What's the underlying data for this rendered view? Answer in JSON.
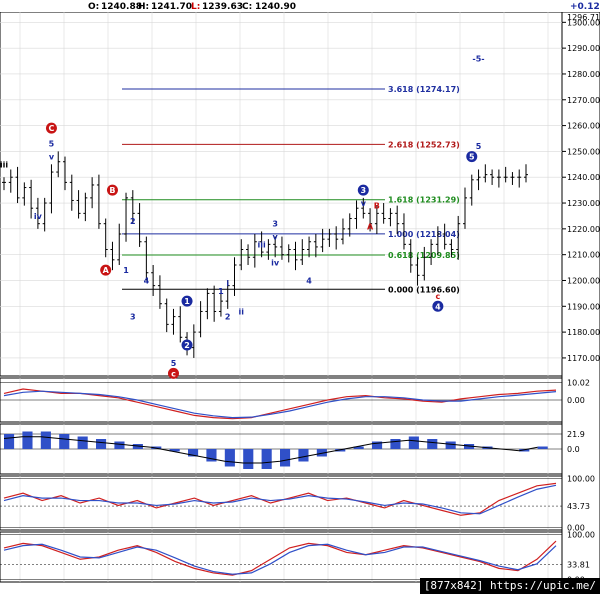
{
  "header": {
    "o_label": "O:",
    "o_value": "1240.88",
    "h_label": "H:",
    "h_value": "1241.70",
    "l_label": "L:",
    "l_value": "1239.63",
    "c_label": "C:",
    "c_value": "1240.90",
    "change": "+0.12"
  },
  "footer": {
    "text": "[877x842] https://upic.me/"
  },
  "colors": {
    "grid": "#d9d9d9",
    "price": "#000000",
    "fib_blue": "#1f2fa0",
    "fib_red": "#b01818",
    "fib_green": "#1e8c1e",
    "wave_blue": "#1a2aa0",
    "wave_red": "#c81414",
    "osc_red": "#d02020",
    "osc_blue": "#3050c8"
  },
  "chart_data": [
    {
      "type": "ohlc",
      "name": "price",
      "ylim": [
        1163,
        1304
      ],
      "yticks": [
        1170,
        1180,
        1190,
        1200,
        1210,
        1220,
        1230,
        1240,
        1250,
        1260,
        1270,
        1280,
        1290,
        1300
      ],
      "ytick_labels": [
        "1170.00",
        "1180.00",
        "1190.00",
        "1200.00",
        "1210.00",
        "1220.00",
        "1230.00",
        "1240.00",
        "1250.00",
        "1260.00",
        "1270.00",
        "1280.00",
        "1290.00",
        "1300.00"
      ],
      "top_label": "1296.71",
      "bars": 78,
      "close": [
        1238,
        1240,
        1232,
        1236,
        1228,
        1222,
        1230,
        1242,
        1246,
        1238,
        1231,
        1226,
        1232,
        1237,
        1222,
        1212,
        1208,
        1218,
        1232,
        1226,
        1215,
        1203,
        1198,
        1191,
        1183,
        1186,
        1178,
        1174,
        1180,
        1188,
        1195,
        1188,
        1192,
        1198,
        1206,
        1212,
        1209,
        1215,
        1211,
        1214,
        1213,
        1210,
        1212,
        1208,
        1212,
        1215,
        1213,
        1216,
        1218,
        1216,
        1220,
        1224,
        1228,
        1226,
        1222,
        1226,
        1224,
        1226,
        1222,
        1214,
        1206,
        1202,
        1209,
        1214,
        1218,
        1214,
        1212,
        1222,
        1232,
        1239,
        1240,
        1241,
        1240,
        1240,
        1240,
        1240,
        1240,
        1241
      ],
      "fib_levels": [
        {
          "ratio": "3.618",
          "value": 1274.17,
          "label": "3.618 (1274.17)",
          "color": "blue"
        },
        {
          "ratio": "2.618",
          "value": 1252.73,
          "label": "2.618 (1252.73)",
          "color": "red"
        },
        {
          "ratio": "1.618",
          "value": 1231.29,
          "label": "1.618 (1231.29)",
          "color": "green"
        },
        {
          "ratio": "1.000",
          "value": 1218.04,
          "label": "1.000 (1218.04)",
          "color": "blue"
        },
        {
          "ratio": "0.618",
          "value": 1209.85,
          "label": "0.618 (1209.85)",
          "color": "green"
        },
        {
          "ratio": "0.000",
          "value": 1196.6,
          "label": "0.000 (1196.60)",
          "color": "black"
        }
      ],
      "wave_labels": [
        {
          "text": "iii",
          "bar": 0,
          "price": 1245,
          "style": "plain-black"
        },
        {
          "text": "C",
          "bar": 7,
          "price": 1259,
          "style": "circle-red"
        },
        {
          "text": "5",
          "bar": 7,
          "price": 1253,
          "style": "plain-blue"
        },
        {
          "text": "v",
          "bar": 7,
          "price": 1248,
          "style": "plain-blue"
        },
        {
          "text": "iv",
          "bar": 5,
          "price": 1225,
          "style": "plain-blue"
        },
        {
          "text": "B",
          "bar": 16,
          "price": 1235,
          "style": "circle-red"
        },
        {
          "text": "2",
          "bar": 19,
          "price": 1223,
          "style": "plain-blue"
        },
        {
          "text": "A",
          "bar": 15,
          "price": 1204,
          "style": "circle-red"
        },
        {
          "text": "1",
          "bar": 18,
          "price": 1204,
          "style": "plain-blue"
        },
        {
          "text": "4",
          "bar": 21,
          "price": 1200,
          "style": "plain-blue"
        },
        {
          "text": "3",
          "bar": 19,
          "price": 1186,
          "style": "plain-blue"
        },
        {
          "text": "1",
          "bar": 27,
          "price": 1192,
          "style": "circle-blue"
        },
        {
          "text": "2",
          "bar": 27,
          "price": 1175,
          "style": "circle-blue"
        },
        {
          "text": "5",
          "bar": 25,
          "price": 1168,
          "style": "plain-blue"
        },
        {
          "text": "c",
          "bar": 25,
          "price": 1164,
          "style": "circle-red"
        },
        {
          "text": "1",
          "bar": 32,
          "price": 1196,
          "style": "plain-blue"
        },
        {
          "text": "i",
          "bar": 33,
          "price": 1199,
          "style": "plain-blue"
        },
        {
          "text": "2",
          "bar": 33,
          "price": 1186,
          "style": "plain-blue"
        },
        {
          "text": "ii",
          "bar": 35,
          "price": 1188,
          "style": "plain-blue"
        },
        {
          "text": "3",
          "bar": 40,
          "price": 1222,
          "style": "plain-blue"
        },
        {
          "text": "v",
          "bar": 40,
          "price": 1217,
          "style": "plain-blue"
        },
        {
          "text": "iii",
          "bar": 38,
          "price": 1214,
          "style": "plain-blue"
        },
        {
          "text": "iv",
          "bar": 40,
          "price": 1207,
          "style": "plain-blue"
        },
        {
          "text": "4",
          "bar": 45,
          "price": 1200,
          "style": "plain-blue"
        },
        {
          "text": "3",
          "bar": 53,
          "price": 1235,
          "style": "circle-blue"
        },
        {
          "text": "v",
          "bar": 53,
          "price": 1230,
          "style": "plain-blue"
        },
        {
          "text": "B",
          "bar": 55,
          "price": 1229,
          "style": "plain-red"
        },
        {
          "text": "A",
          "bar": 54,
          "price": 1221,
          "style": "plain-red"
        },
        {
          "text": "c",
          "bar": 64,
          "price": 1194,
          "style": "plain-red"
        },
        {
          "text": "4",
          "bar": 64,
          "price": 1190,
          "style": "circle-blue"
        },
        {
          "text": "5",
          "bar": 69,
          "price": 1248,
          "style": "circle-blue"
        },
        {
          "text": "5",
          "bar": 70,
          "price": 1252,
          "style": "plain-blue"
        },
        {
          "text": "-5-",
          "bar": 70,
          "price": 1286,
          "style": "plain-blue"
        }
      ]
    },
    {
      "type": "line",
      "name": "macd",
      "ylim": [
        -1,
        1
      ],
      "yticks": [
        0.8,
        0
      ],
      "ytick_labels": [
        "10.02",
        "0.00"
      ],
      "series": [
        {
          "color": "red",
          "values": [
            0.3,
            0.5,
            0.4,
            0.3,
            0.3,
            0.2,
            0.1,
            -0.1,
            -0.3,
            -0.5,
            -0.7,
            -0.8,
            -0.85,
            -0.8,
            -0.6,
            -0.4,
            -0.2,
            0.0,
            0.15,
            0.2,
            0.1,
            0.05,
            -0.05,
            -0.1,
            0.05,
            0.15,
            0.25,
            0.3,
            0.4,
            0.45
          ]
        },
        {
          "color": "blue",
          "values": [
            0.2,
            0.35,
            0.4,
            0.35,
            0.3,
            0.25,
            0.15,
            0.0,
            -0.2,
            -0.4,
            -0.6,
            -0.72,
            -0.8,
            -0.78,
            -0.65,
            -0.5,
            -0.3,
            -0.1,
            0.05,
            0.15,
            0.15,
            0.1,
            0.0,
            -0.05,
            -0.05,
            0.05,
            0.15,
            0.22,
            0.3,
            0.38
          ]
        }
      ]
    },
    {
      "type": "bar",
      "name": "histogram",
      "ylim": [
        -1,
        1
      ],
      "yticks": [
        0.6,
        0
      ],
      "ytick_labels": [
        "21.9",
        "0.0"
      ],
      "values": [
        0.6,
        0.7,
        0.7,
        0.6,
        0.5,
        0.4,
        0.3,
        0.2,
        0.1,
        -0.1,
        -0.3,
        -0.5,
        -0.7,
        -0.8,
        -0.8,
        -0.7,
        -0.5,
        -0.3,
        -0.1,
        0.1,
        0.3,
        0.4,
        0.5,
        0.4,
        0.3,
        0.2,
        0.1,
        0.0,
        -0.1,
        0.1
      ]
    },
    {
      "type": "line",
      "name": "stoch-fast",
      "ylim": [
        -5,
        105
      ],
      "yticks": [
        100,
        43.73,
        0
      ],
      "ytick_labels": [
        "100.00",
        "43.73",
        "0.00"
      ],
      "series": [
        {
          "color": "red",
          "values": [
            60,
            70,
            55,
            65,
            50,
            60,
            45,
            55,
            40,
            50,
            60,
            45,
            55,
            65,
            50,
            60,
            70,
            55,
            60,
            50,
            40,
            55,
            45,
            35,
            25,
            30,
            55,
            70,
            85,
            90
          ]
        },
        {
          "color": "blue",
          "values": [
            55,
            65,
            60,
            60,
            55,
            55,
            50,
            50,
            45,
            48,
            55,
            50,
            52,
            60,
            55,
            58,
            65,
            60,
            58,
            52,
            45,
            50,
            48,
            40,
            30,
            28,
            45,
            62,
            78,
            86
          ]
        }
      ]
    },
    {
      "type": "line",
      "name": "stoch-slow",
      "ylim": [
        -5,
        105
      ],
      "yticks": [
        100,
        33.81,
        0
      ],
      "ytick_labels": [
        "100.00",
        "33.81",
        "0.00"
      ],
      "series": [
        {
          "color": "red",
          "values": [
            70,
            80,
            75,
            60,
            45,
            50,
            65,
            75,
            60,
            40,
            25,
            15,
            10,
            20,
            45,
            70,
            80,
            75,
            60,
            55,
            65,
            75,
            70,
            60,
            50,
            40,
            25,
            20,
            45,
            85
          ]
        },
        {
          "color": "blue",
          "values": [
            65,
            75,
            78,
            65,
            50,
            48,
            60,
            72,
            65,
            48,
            30,
            18,
            12,
            15,
            35,
            60,
            75,
            78,
            65,
            55,
            60,
            72,
            72,
            62,
            52,
            42,
            30,
            22,
            35,
            75
          ]
        }
      ]
    }
  ]
}
